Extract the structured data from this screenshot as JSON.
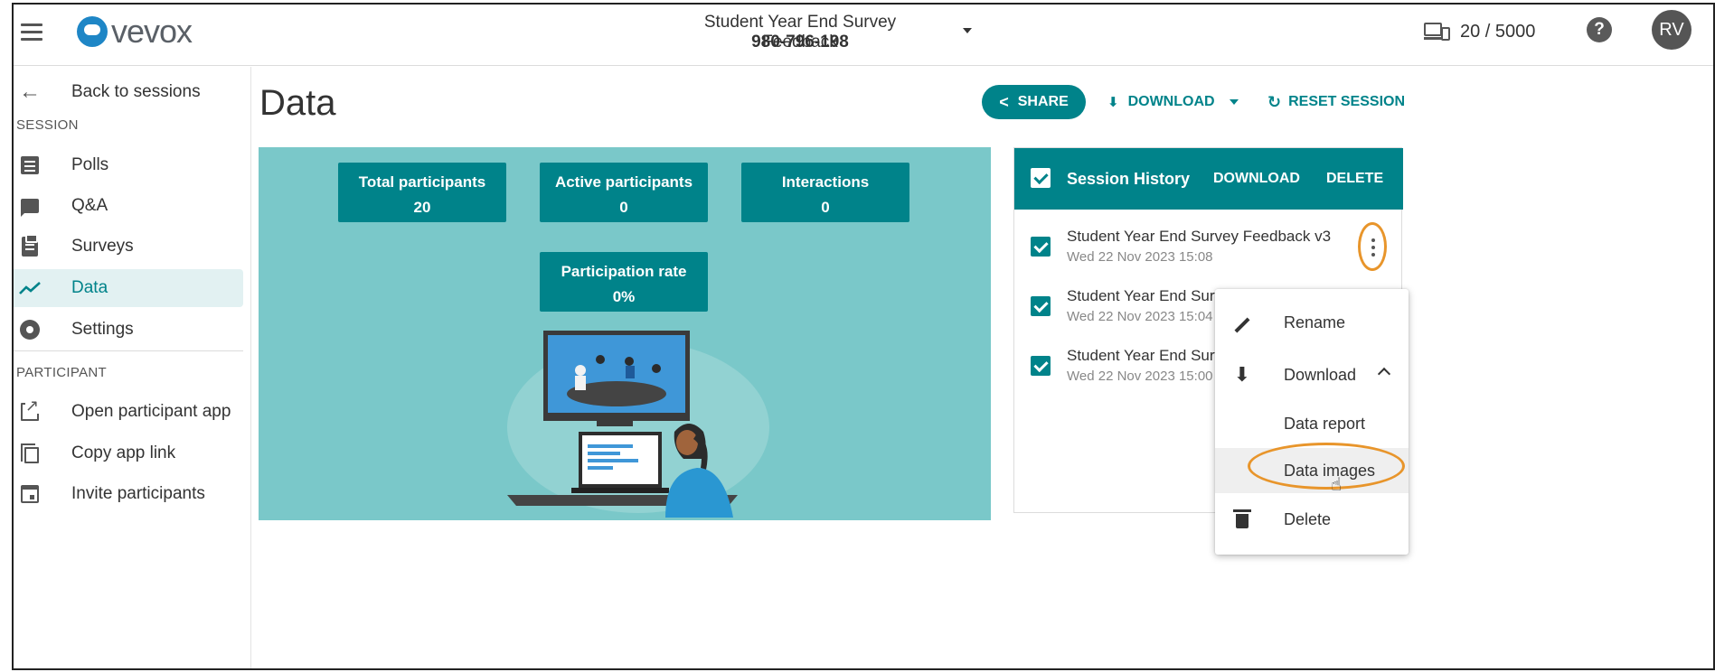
{
  "header": {
    "logo_text": "vevox",
    "session_title": "Student Year End Survey Feedback",
    "session_code": "980-796-198",
    "participants": "20 / 5000",
    "help_glyph": "?",
    "avatar_initials": "RV"
  },
  "sidebar": {
    "back_label": "Back to sessions",
    "session_section": "SESSION",
    "participant_section": "PARTICIPANT",
    "items": [
      {
        "label": "Polls",
        "icon": "polls-icon"
      },
      {
        "label": "Q&A",
        "icon": "qa-chat-icon"
      },
      {
        "label": "Surveys",
        "icon": "clipboard-icon"
      },
      {
        "label": "Data",
        "icon": "trending-icon",
        "active": true
      },
      {
        "label": "Settings",
        "icon": "gear-icon"
      }
    ],
    "participant_items": [
      {
        "label": "Open participant app",
        "icon": "open-external-icon"
      },
      {
        "label": "Copy app link",
        "icon": "copy-icon"
      },
      {
        "label": "Invite participants",
        "icon": "calendar-icon"
      }
    ]
  },
  "main": {
    "title": "Data",
    "share_label": "SHARE",
    "download_label": "DOWNLOAD",
    "reset_label": "RESET SESSION",
    "stats": [
      {
        "label": "Total participants",
        "value": "20"
      },
      {
        "label": "Active participants",
        "value": "0"
      },
      {
        "label": "Interactions",
        "value": "0"
      },
      {
        "label": "Participation rate",
        "value": "0%"
      }
    ]
  },
  "history": {
    "title": "Session History",
    "download_label": "DOWNLOAD",
    "delete_label": "DELETE",
    "rows": [
      {
        "name": "Student Year End Survey Feedback v3",
        "date": "Wed 22 Nov 2023 15:08"
      },
      {
        "name": "Student Year End Surve",
        "date": "Wed 22 Nov 2023 15:04"
      },
      {
        "name": "Student Year End Surve",
        "date": "Wed 22 Nov 2023 15:00"
      }
    ]
  },
  "context_menu": {
    "rename": "Rename",
    "download": "Download",
    "data_report": "Data report",
    "data_images": "Data images",
    "delete": "Delete"
  },
  "colors": {
    "accent": "#00838a",
    "panel": "#7ac8c9",
    "highlight_ring": "#e8952b"
  }
}
